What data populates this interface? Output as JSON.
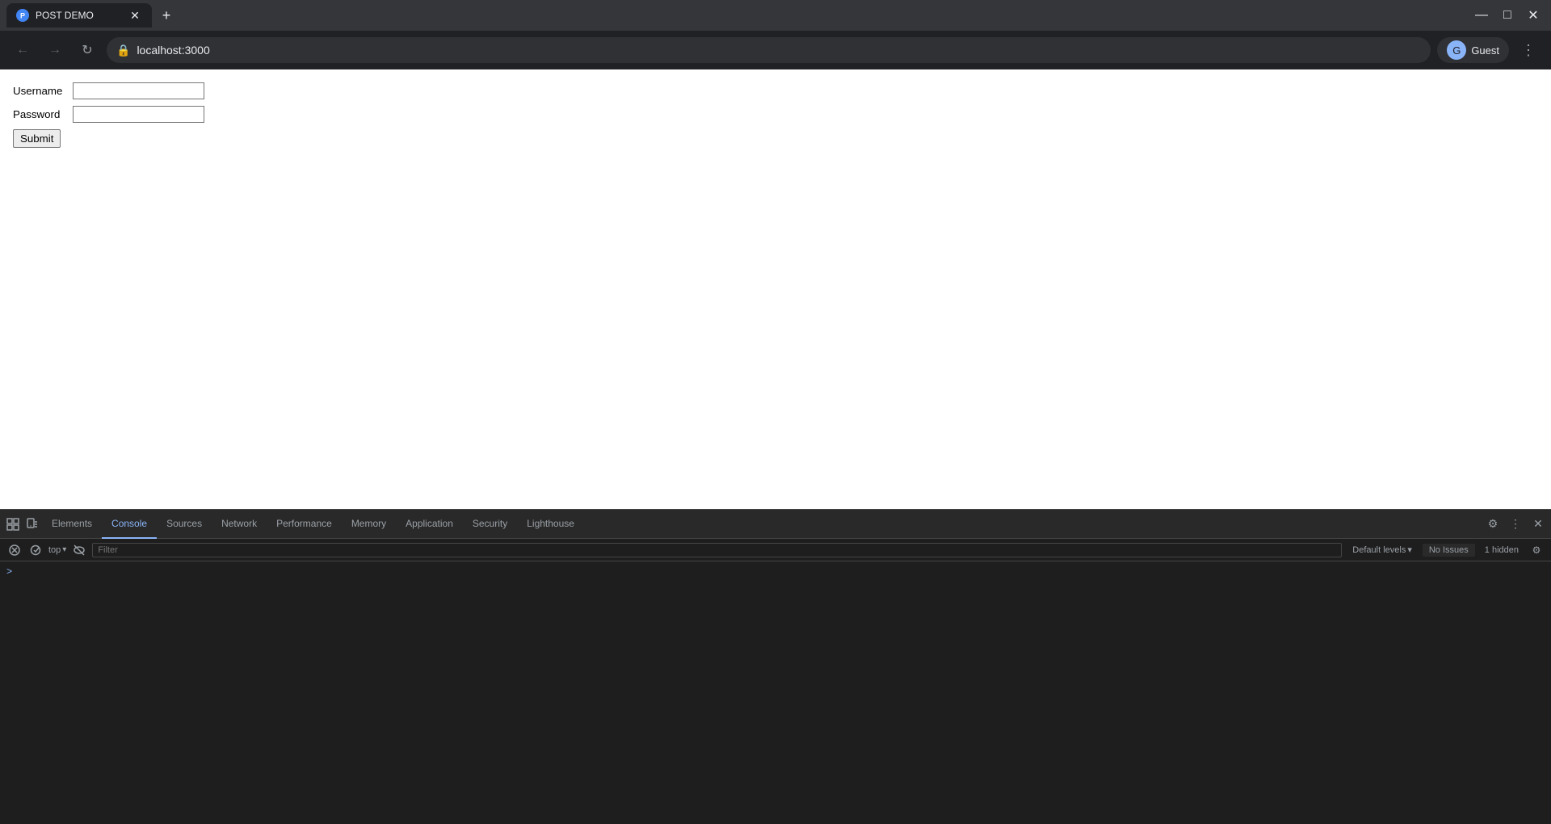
{
  "browser": {
    "tab": {
      "title": "POST DEMO",
      "favicon_letter": "P"
    },
    "controls": {
      "minimize": "—",
      "maximize": "□",
      "close": "✕",
      "new_tab": "+"
    },
    "nav": {
      "back": "←",
      "forward": "→",
      "reload": "↻"
    },
    "address": "localhost:3000",
    "profile": {
      "label": "Guest"
    },
    "menu": "⋮"
  },
  "page": {
    "form": {
      "username_label": "Username",
      "password_label": "Password",
      "submit_label": "Submit"
    }
  },
  "devtools": {
    "tabs": [
      {
        "id": "elements",
        "label": "Elements"
      },
      {
        "id": "console",
        "label": "Console"
      },
      {
        "id": "sources",
        "label": "Sources"
      },
      {
        "id": "network",
        "label": "Network"
      },
      {
        "id": "performance",
        "label": "Performance"
      },
      {
        "id": "memory",
        "label": "Memory"
      },
      {
        "id": "application",
        "label": "Application"
      },
      {
        "id": "security",
        "label": "Security"
      },
      {
        "id": "lighthouse",
        "label": "Lighthouse"
      }
    ],
    "active_tab": "console",
    "toolbar": {
      "clear_icon": "🚫",
      "context_label": "top",
      "context_arrow": "▾",
      "eye_icon": "👁",
      "filter_placeholder": "Filter",
      "levels_label": "Default levels",
      "levels_arrow": "▾",
      "no_issues": "No Issues",
      "hidden_count": "1 hidden"
    },
    "settings_icon": "⚙",
    "more_icon": "⋮",
    "close_icon": "✕",
    "dock_icon": "⊞",
    "inspect_icon": "⊡",
    "console_prompt": ">"
  }
}
